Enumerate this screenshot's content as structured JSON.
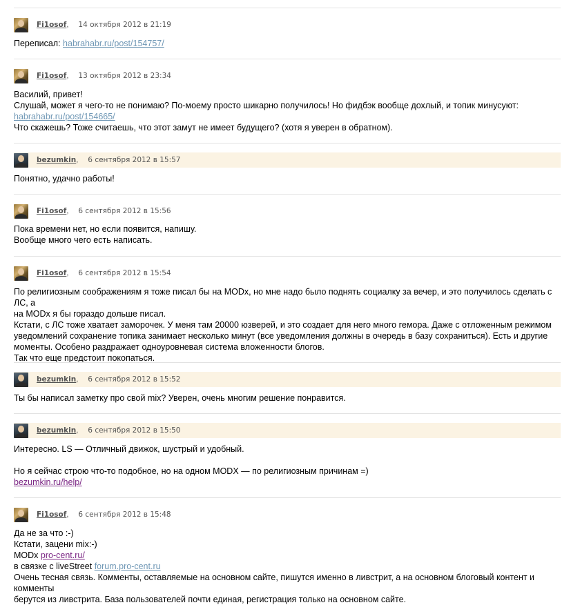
{
  "users": {
    "filosof": "Fi1osof",
    "bezumkin": "bezumkin"
  },
  "colors": {
    "link": "#6f97b5",
    "link_visited": "#7b2684",
    "highlight_header": "#fbf3e3",
    "meta_text": "#555555"
  },
  "comments": [
    {
      "author": "Fi1osof",
      "date": "14 октября 2012 в 21:19",
      "highlight": false,
      "lines": [
        {
          "text": "Переписал: ",
          "link": "habrahabr.ru/post/154757/"
        }
      ]
    },
    {
      "author": "Fi1osof",
      "date": "13 октября 2012 в 23:34",
      "highlight": false,
      "lines": [
        {
          "text": "Василий, привет!"
        },
        {
          "text": "Слушай, может я чего-то не понимаю? По-моему просто шикарно получилось! Но фидбэк вообще дохлый, и топик минусуют:"
        },
        {
          "link": "habrahabr.ru/post/154665/"
        },
        {
          "text": "Что скажешь? Тоже считаешь, что этот замут не имеет будущего? (хотя я уверен в обратном)."
        }
      ]
    },
    {
      "author": "bezumkin",
      "date": "6 сентября 2012 в 15:57",
      "highlight": true,
      "lines": [
        {
          "text": "Понятно, удачно работы!"
        }
      ]
    },
    {
      "author": "Fi1osof",
      "date": "6 сентября 2012 в 15:56",
      "highlight": false,
      "lines": [
        {
          "text": "Пока времени нет, но если появится, напишу."
        },
        {
          "text": "Вообще много чего есть написать."
        }
      ]
    },
    {
      "author": "Fi1osof",
      "date": "6 сентября 2012 в 15:54",
      "highlight": false,
      "lines": [
        {
          "text": "По религиозным соображениям я тоже писал бы на MODx, но мне надо было поднять социалку за вечер, и это получилось сделать с ЛС, а"
        },
        {
          "text": "на MODx я бы гораздо дольше писал."
        },
        {
          "text": "Кстати, с ЛС тоже хватает заморочек. У меня там 20000 юзверей, и это создает для него много гемора. Даже с отложенным режимом"
        },
        {
          "text": "уведомлений сохранение топика занимает несколько минут (все уведомления должны в очередь в базу сохраниться). Есть и другие"
        },
        {
          "text": "моменты. Особено раздражает одноуровневая система вложенности блогов."
        },
        {
          "text": "Так что еще предстоит покопаться."
        }
      ]
    },
    {
      "author": "bezumkin",
      "date": "6 сентября 2012 в 15:52",
      "highlight": true,
      "lines": [
        {
          "text": "Ты бы написал заметку про свой mix? Уверен, очень многим решение понравится."
        }
      ]
    },
    {
      "author": "bezumkin",
      "date": "6 сентября 2012 в 15:50",
      "highlight": true,
      "lines": [
        {
          "text": "Интересно. LS — Отличный движок, шустрый и удобный."
        },
        {
          "text": ""
        },
        {
          "text": "Но я сейчас строю что-то подобное, но на одном MODX — по религиозным причинам =)"
        },
        {
          "link": "bezumkin.ru/help/",
          "visited": true
        }
      ]
    },
    {
      "author": "Fi1osof",
      "date": "6 сентября 2012 в 15:48",
      "highlight": false,
      "lines": [
        {
          "text": "Да не за что :-)"
        },
        {
          "text": "Кстати, зацени mix:-)"
        },
        {
          "text": "MODx ",
          "link": "pro-cent.ru/",
          "visited": true
        },
        {
          "text": "в связке с liveStreet ",
          "link": "forum.pro-cent.ru"
        },
        {
          "text": "Очень тесная связь. Комменты, оставляемые на основном сайте, пишутся именно в ливстрит, а на основном блоговый контент и комменты"
        },
        {
          "text": "берутся из ливстрита. База пользователей почти единая, регистрация только на основном сайте."
        }
      ]
    }
  ]
}
